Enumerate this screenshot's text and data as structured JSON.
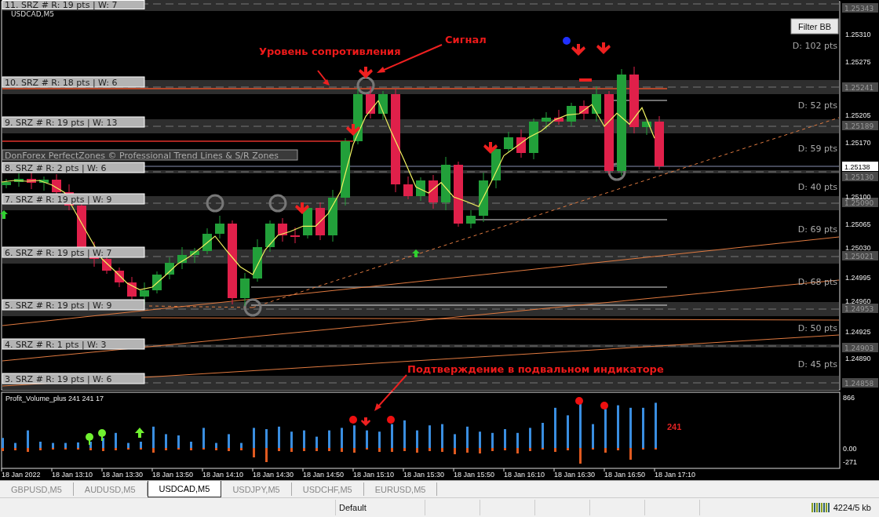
{
  "chart": {
    "symbol": "USDCAD,M5",
    "indicator_label": "DonForex PerfectZones © Professional Trend Lines & S/R Zones",
    "filter_button": "Filter BB",
    "zones": [
      {
        "label": "11. SRZ # R: 19 pts | W: 7",
        "price": "1.25343"
      },
      {
        "label": "10. SRZ # R: 18 pts | W: 6",
        "price": "1.25241"
      },
      {
        "label": "9. SRZ # R: 19 pts | W: 13",
        "price": "1.25189"
      },
      {
        "label": "8. SRZ # R: 2 pts | W: 6",
        "price": "1.25130"
      },
      {
        "label": "7. SRZ # R: 19 pts | W: 9",
        "price": "1.25090"
      },
      {
        "label": "6. SRZ # R: 19 pts | W: 7",
        "price": "1.25021"
      },
      {
        "label": "5. SRZ # R: 19 pts | W: 9",
        "price": "1.24953"
      },
      {
        "label": "4. SRZ # R: 1 pts | W: 3",
        "price": "1.24903"
      },
      {
        "label": "3. SRZ # R: 19 pts | W: 6",
        "price": "1.24858"
      }
    ],
    "distances": [
      "D: 102 pts",
      "D: 52 pts",
      "D: 59 pts",
      "D: 40 pts",
      "D: 69 pts",
      "D: 68 pts",
      "D: 50 pts",
      "D: 45 pts"
    ],
    "price_ticks": [
      "1.25310",
      "1.25275",
      "1.25205",
      "1.25170",
      "1.25100",
      "1.25065",
      "1.25030",
      "1.24995",
      "1.24960",
      "1.24925",
      "1.24890"
    ],
    "current_price": "1.25138",
    "annotations": [
      "Уровень сопротивления",
      "Сигнал",
      "Подтверждение в подвальном индикаторе"
    ]
  },
  "indicator": {
    "title": "Profit_Volume_plus 241 241 17",
    "value_label": "241",
    "scale": [
      "866",
      "0.00",
      "-271"
    ]
  },
  "time_axis": [
    "18 Jan 2022",
    "18 Jan 13:10",
    "18 Jan 13:30",
    "18 Jan 13:50",
    "18 Jan 14:10",
    "18 Jan 14:30",
    "18 Jan 14:50",
    "18 Jan 15:10",
    "18 Jan 15:30",
    "18 Jan 15:50",
    "18 Jan 16:10",
    "18 Jan 16:30",
    "18 Jan 16:50",
    "18 Jan 17:10"
  ],
  "tabs": [
    {
      "label": "GBPUSD,M5",
      "selected": false
    },
    {
      "label": "AUDUSD,M5",
      "selected": false
    },
    {
      "label": "USDCAD,M5",
      "selected": true
    },
    {
      "label": "USDJPY,M5",
      "selected": false
    },
    {
      "label": "USDCHF,M5",
      "selected": false
    },
    {
      "label": "EURUSD,M5",
      "selected": false
    }
  ],
  "status_bar": {
    "profile": "Default",
    "traffic": "4224/5 kb"
  }
}
